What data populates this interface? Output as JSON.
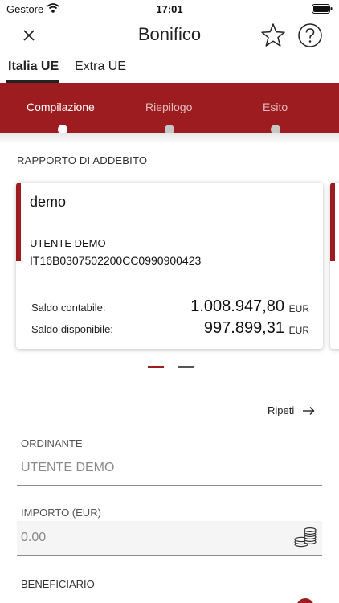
{
  "status_bar": {
    "carrier": "Gestore",
    "time": "17:01"
  },
  "header": {
    "title": "Bonifico"
  },
  "tabs": [
    {
      "label": "Italia UE",
      "active": true
    },
    {
      "label": "Extra UE",
      "active": false
    }
  ],
  "steps": [
    {
      "label": "Compilazione",
      "active": true
    },
    {
      "label": "Riepilogo",
      "active": false
    },
    {
      "label": "Esito",
      "active": false
    }
  ],
  "debit_section": {
    "title": "RAPPORTO DI ADDEBITO"
  },
  "account_card": {
    "name": "demo",
    "holder": "UTENTE DEMO",
    "iban": "IT16B0307502200CC0990900423",
    "balances": [
      {
        "label": "Saldo contabile:",
        "value": "1.008.947,80",
        "currency": "EUR"
      },
      {
        "label": "Saldo disponibile:",
        "value": "997.899,31",
        "currency": "EUR"
      }
    ]
  },
  "carousel": {
    "pages": 2,
    "current": 1
  },
  "repeat_label": "Ripeti",
  "form": {
    "ordinante": {
      "label": "ORDINANTE",
      "value": "UTENTE DEMO"
    },
    "importo": {
      "label": "IMPORTO (EUR)",
      "placeholder": "0.00"
    },
    "beneficiario": {
      "label": "BENEFICIARIO"
    }
  },
  "colors": {
    "brand": "#9c1c1f",
    "step_inactive": "#e3bcbd"
  },
  "icons": {
    "close": "close-icon",
    "favorite": "star-icon",
    "help": "help-icon",
    "repeat": "arrow-right-icon",
    "amount": "coins-icon"
  }
}
